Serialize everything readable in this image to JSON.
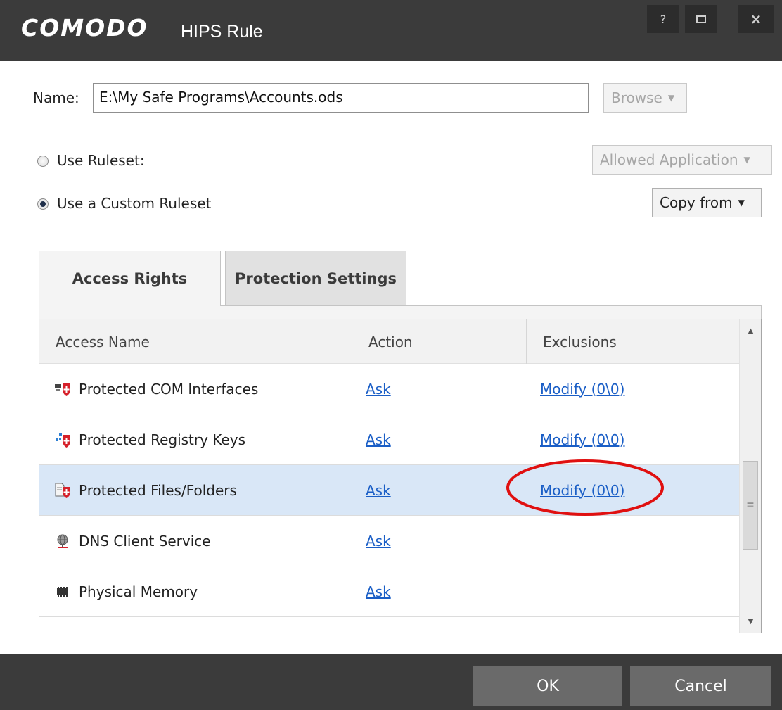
{
  "window": {
    "brand": "COMODO",
    "title": "HIPS Rule",
    "help_label": "?",
    "close_label": "×"
  },
  "form": {
    "name_label": "Name:",
    "name_value": "E:\\My Safe Programs\\Accounts.ods",
    "browse_label": "Browse",
    "use_ruleset_label": "Use Ruleset:",
    "ruleset_value": "Allowed Application",
    "use_custom_label": "Use a Custom Ruleset",
    "copy_from_label": "Copy from",
    "selected_option": "Use a Custom Ruleset"
  },
  "tabs": [
    {
      "label": "Access Rights",
      "active": true
    },
    {
      "label": "Protection Settings",
      "active": false
    }
  ],
  "table": {
    "columns": [
      "Access Name",
      "Action",
      "Exclusions"
    ],
    "rows": [
      {
        "icon": "com-interface-shield-icon",
        "name": "Protected COM Interfaces",
        "action": "Ask",
        "exclusions": "Modify (0\\0)",
        "selected": false
      },
      {
        "icon": "registry-shield-icon",
        "name": "Protected Registry Keys",
        "action": "Ask",
        "exclusions": "Modify (0\\0)",
        "selected": false
      },
      {
        "icon": "file-shield-icon",
        "name": "Protected Files/Folders",
        "action": "Ask",
        "exclusions": "Modify (0\\0)",
        "selected": true
      },
      {
        "icon": "dns-globe-icon",
        "name": "DNS Client Service",
        "action": "Ask",
        "exclusions": "",
        "selected": false
      },
      {
        "icon": "memory-chip-icon",
        "name": "Physical Memory",
        "action": "Ask",
        "exclusions": "",
        "selected": false
      }
    ]
  },
  "footer": {
    "ok_label": "OK",
    "cancel_label": "Cancel"
  },
  "colors": {
    "titlebar": "#3b3b3b",
    "link": "#1a5ec6",
    "selected_row": "#d9e7f7",
    "annotation_circle": "#e01010"
  }
}
